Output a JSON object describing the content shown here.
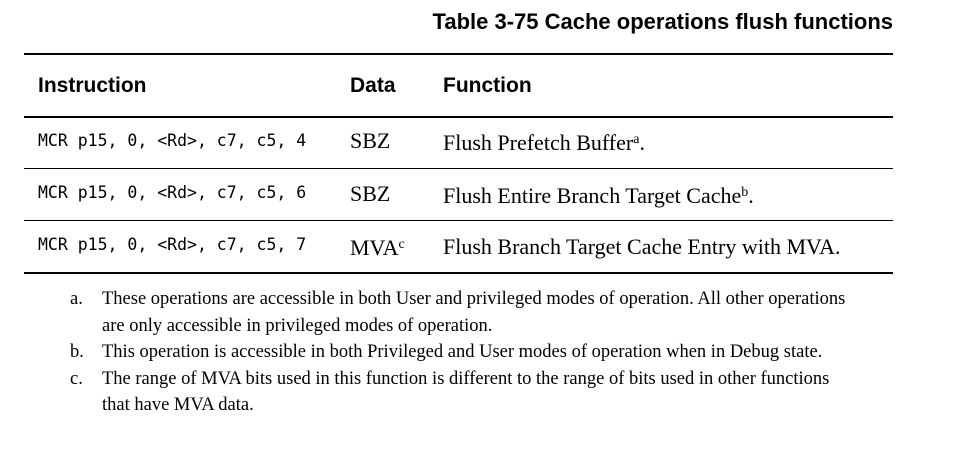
{
  "table": {
    "title": "Table 3-75 Cache operations flush functions",
    "headers": {
      "instruction": "Instruction",
      "data": "Data",
      "function": "Function"
    },
    "rows": [
      {
        "instruction": "MCR p15, 0, <Rd>, c7, c5, 4",
        "data": "SBZ",
        "data_sup": "",
        "function": "Flush Prefetch Buffer",
        "function_sup": "a",
        "function_end": "."
      },
      {
        "instruction": "MCR p15, 0, <Rd>, c7, c5, 6",
        "data": "SBZ",
        "data_sup": "",
        "function": "Flush Entire Branch Target Cache",
        "function_sup": "b",
        "function_end": "."
      },
      {
        "instruction": "MCR p15, 0, <Rd>, c7, c5, 7",
        "data": "MVA",
        "data_sup": "c",
        "function": "Flush Branch Target Cache Entry with MVA.",
        "function_sup": "",
        "function_end": ""
      }
    ]
  },
  "footnotes": [
    {
      "mark": "a.",
      "text": "These operations are accessible in both User and privileged modes of operation. All other operations are only accessible in privileged modes of operation."
    },
    {
      "mark": "b.",
      "text": "This operation is accessible in both Privileged and User modes of operation when in Debug state."
    },
    {
      "mark": "c.",
      "text": "The range of MVA bits used in this function is different to the range of bits used in other functions that have MVA data."
    }
  ]
}
